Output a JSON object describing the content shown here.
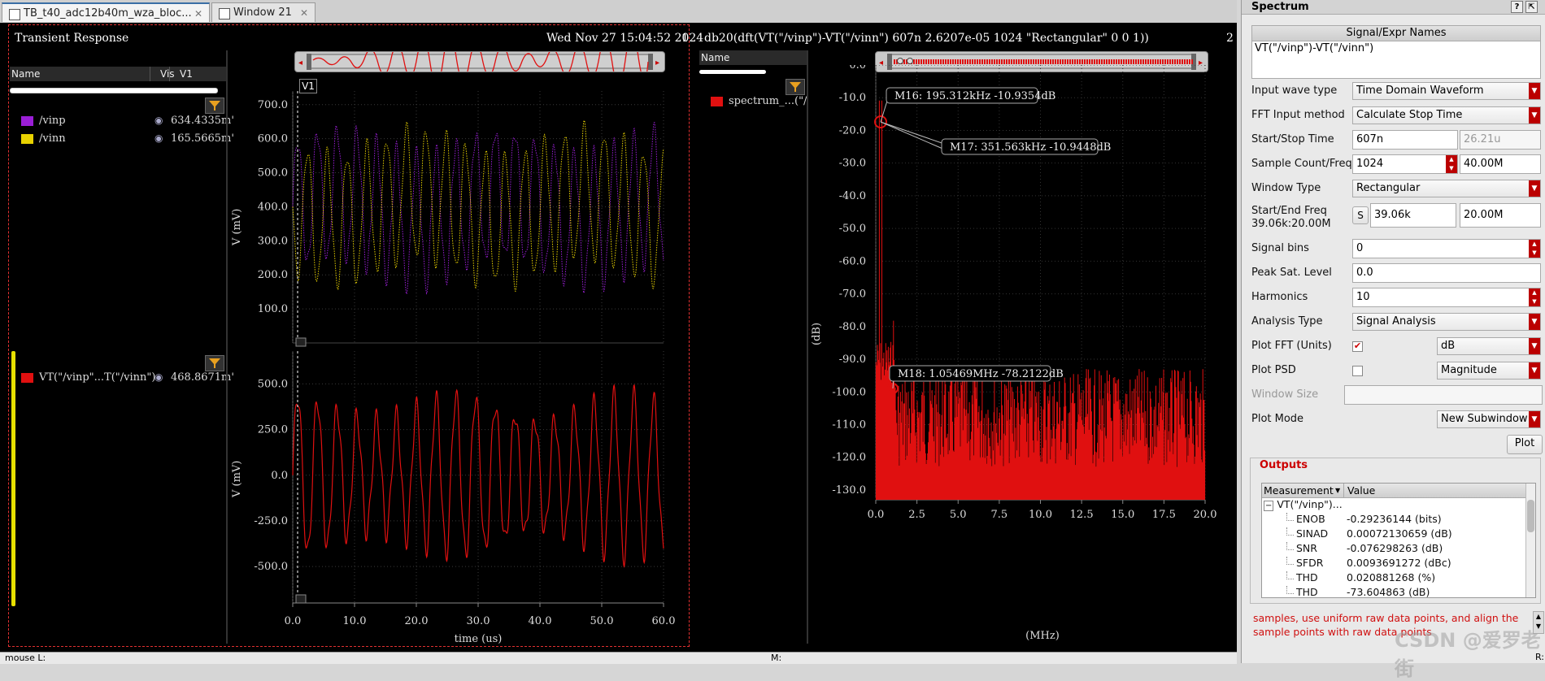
{
  "tabs": [
    {
      "label": "TB_t40_adc12b40m_wza_bloc...",
      "active": true
    },
    {
      "label": "Window 21",
      "active": false
    }
  ],
  "left_pane": {
    "title": "Transient Response",
    "timestamp": "Wed Nov 27 15:04:52 2024",
    "pane_number": "1",
    "columns": {
      "name": "Name",
      "vis": "Vis",
      "v1": "V1"
    },
    "top_signals": [
      {
        "name": "/vinp",
        "color": "#9a1ed6",
        "value": "634.4335m'"
      },
      {
        "name": "/vinn",
        "color": "#e8d200",
        "value": "165.5665m'"
      }
    ],
    "bottom_signals": [
      {
        "name": "VT(\"/vinp\"...T(\"/vinn\")",
        "color": "#e01010",
        "value": "468.8671m'"
      }
    ],
    "marker_label": "V1"
  },
  "top_plot": {
    "ylabel": "V (mV)",
    "yticks": [
      "700.0",
      "600.0",
      "500.0",
      "400.0",
      "300.0",
      "200.0",
      "100.0"
    ]
  },
  "bottom_plot": {
    "ylabel": "V (mV)",
    "yticks": [
      "500.0",
      "250.0",
      "0.0",
      "-250.0",
      "-500.0"
    ],
    "xticks": [
      "0.0",
      "10.0",
      "20.0",
      "30.0",
      "40.0",
      "50.0",
      "60.0"
    ],
    "xlabel": "time (us)"
  },
  "right_pane": {
    "title": "db20(dft(VT(\"/vinp\")-VT(\"/vinn\")  607n 2.6207e-05 1024 \"Rectangular\" 0 0 1))",
    "pane_number": "2",
    "col_name": "Name",
    "signal": {
      "name": "spectrum_...(\"/vi",
      "color": "#e01010"
    }
  },
  "spectrum_plot": {
    "ylabel": "(dB)",
    "xlabel": "(MHz)",
    "yticks": [
      "0.0",
      "-10.0",
      "-20.0",
      "-30.0",
      "-40.0",
      "-50.0",
      "-60.0",
      "-70.0",
      "-80.0",
      "-90.0",
      "-100.0",
      "-110.0",
      "-120.0",
      "-130.0"
    ],
    "xticks": [
      "0.0",
      "2.5",
      "5.0",
      "7.5",
      "10.0",
      "12.5",
      "15.0",
      "17.5",
      "20.0"
    ],
    "markers": {
      "m16": "M16: 195.312kHz -10.9354dB",
      "m17": "M17: 351.563kHz -10.9448dB",
      "m18": "M18: 1.05469MHz -78.2122dB"
    }
  },
  "spectrum_panel": {
    "title": "Spectrum",
    "signal_header": "Signal/Expr Names",
    "signal_expr": "VT(\"/vinp\")-VT(\"/vinn\")",
    "input_wave_type": {
      "label": "Input wave type",
      "value": "Time Domain Waveform"
    },
    "fft_input_method": {
      "label": "FFT Input method",
      "value": "Calculate Stop Time"
    },
    "start_stop_time": {
      "label": "Start/Stop Time",
      "start": "607n",
      "stop": "26.21u"
    },
    "sample_count": {
      "label": "Sample Count/Freq",
      "count": "1024",
      "freq": "40.00M"
    },
    "window_type": {
      "label": "Window Type",
      "value": "Rectangular"
    },
    "start_end_freq": {
      "label": "Start/End Freq",
      "sub": "39.06k:20.00M",
      "s_btn": "S",
      "start": "39.06k",
      "end": "20.00M"
    },
    "signal_bins": {
      "label": "Signal bins",
      "value": "0"
    },
    "peak_sat": {
      "label": "Peak Sat. Level",
      "value": "0.0"
    },
    "harmonics": {
      "label": "Harmonics",
      "value": "10"
    },
    "analysis_type": {
      "label": "Analysis Type",
      "value": "Signal Analysis"
    },
    "plot_fft": {
      "label": "Plot FFT (Units)",
      "checked": true,
      "value": "dB"
    },
    "plot_psd": {
      "label": "Plot PSD",
      "checked": false,
      "value": "Magnitude"
    },
    "window_size": {
      "label": "Window Size"
    },
    "plot_mode": {
      "label": "Plot Mode",
      "value": "New Subwindow"
    },
    "plot_button": "Plot",
    "outputs_title": "Outputs",
    "outputs_columns": {
      "measurement": "Measurement",
      "value": "Value"
    },
    "outputs_group": "VT(\"/vinp\")...",
    "outputs": [
      {
        "name": "ENOB",
        "value": "-0.29236144 (bits)"
      },
      {
        "name": "SINAD",
        "value": "0.00072130659 (dB)"
      },
      {
        "name": "SNR",
        "value": "-0.076298263 (dB)"
      },
      {
        "name": "SFDR",
        "value": "0.0093691272 (dBc)"
      },
      {
        "name": "THD",
        "value": "0.020881268 (%)"
      },
      {
        "name": "THD",
        "value": "-73.604863 (dB)"
      }
    ],
    "note": "samples, use uniform raw data points, and align the sample points with raw data points",
    "watermark": "CSDN @爱罗老街"
  },
  "status_bar": {
    "mouse": "mouse L:",
    "m": "M:",
    "r": "R:"
  }
}
